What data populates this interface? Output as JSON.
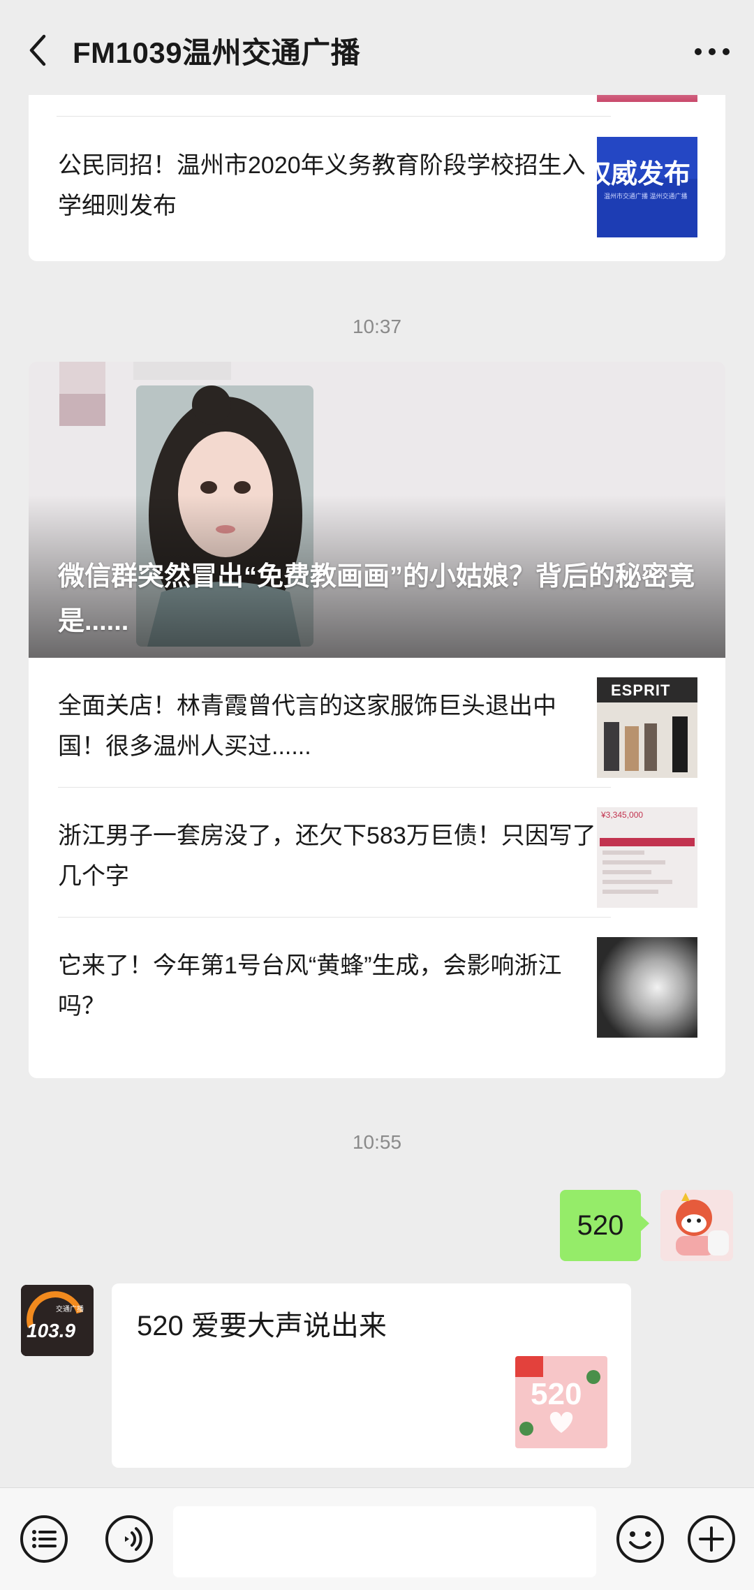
{
  "header": {
    "title": "FM1039温州交通广播",
    "back_icon": "chevron-left-icon",
    "more_icon": "more-horizontal-icon"
  },
  "previous_article": {
    "title": "公民同招！温州市2020年义务教育阶段学校招生入学细则发布",
    "thumb_text": "权威发布",
    "thumb_subtext": "温州市交通广播 温州交通广播"
  },
  "timestamps": [
    "10:37",
    "10:55"
  ],
  "main_card": {
    "cover_title": "微信群突然冒出“免费教画画”的小姑娘？背后的秘密竟是......",
    "articles": [
      {
        "title": "全面关店！林青霞曾代言的这家服饰巨头退出中国！很多温州人买过......",
        "thumb_label": "ESPRIT"
      },
      {
        "title": "浙江男子一套房没了，还欠下583万巨债！只因写了几个字",
        "thumb_label": "¥3,345,000"
      },
      {
        "title": "它来了！今年第1号台风“黄蜂”生成，会影响浙江吗？",
        "thumb_label": ""
      }
    ]
  },
  "chat": {
    "sent_message": "520",
    "received_message": "520 爱要大声说出来",
    "received_avatar_text": "103.9",
    "received_avatar_subtext": "交通广播",
    "received_image_text": "520"
  },
  "bottom_bar": {
    "menu_icon": "menu-list-icon",
    "voice_icon": "voice-icon",
    "emoji_icon": "emoji-icon",
    "plus_icon": "plus-icon",
    "input_value": ""
  },
  "colors": {
    "background": "#ededed",
    "sent_bubble": "#95ec69",
    "card": "#ffffff",
    "timestamp": "#8a8a8a"
  }
}
